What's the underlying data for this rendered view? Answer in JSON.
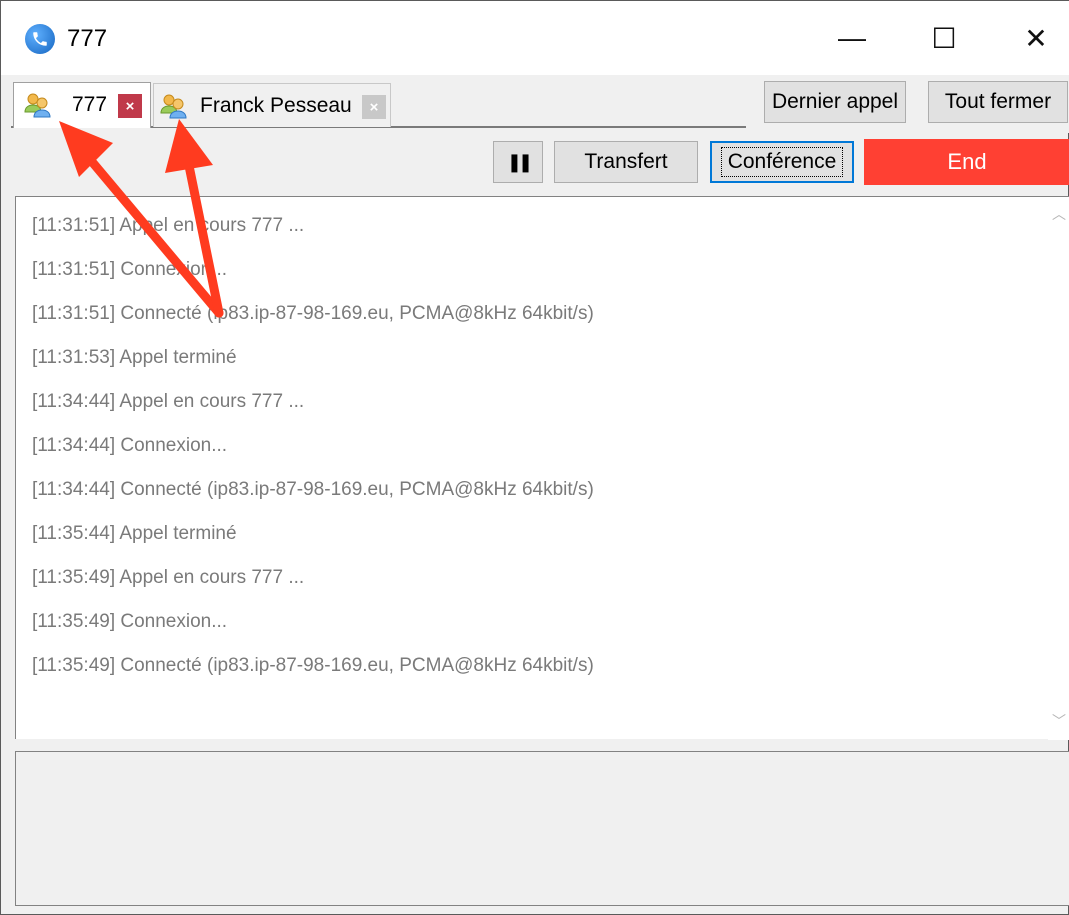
{
  "window": {
    "title": "777",
    "minimize_glyph": "—",
    "maximize_glyph": "☐",
    "close_glyph": "✕"
  },
  "tabs": [
    {
      "label": "777",
      "close_glyph": "×",
      "active": true,
      "icon": "users-icon"
    },
    {
      "label": "Franck Pesseau",
      "close_glyph": "×",
      "active": false,
      "icon": "users-icon"
    }
  ],
  "toolbar": {
    "last_call_label": "Dernier appel",
    "close_all_label": "Tout fermer"
  },
  "call_controls": {
    "pause_glyph": "❚❚",
    "transfer_label": "Transfert",
    "conference_label": "Conférence",
    "end_label": "End",
    "end_color": "#ff4033"
  },
  "log": [
    "[11:31:51]  Appel en cours 777 ...",
    "[11:31:51]  Connexion...",
    "[11:31:51]  Connecté (ip83.ip-87-98-169.eu, PCMA@8kHz 64kbit/s)",
    "[11:31:53]  Appel terminé",
    "[11:34:44]  Appel en cours 777 ...",
    "[11:34:44]  Connexion...",
    "[11:34:44]  Connecté (ip83.ip-87-98-169.eu, PCMA@8kHz 64kbit/s)",
    "[11:35:44]  Appel terminé",
    "[11:35:49]  Appel en cours 777 ...",
    "[11:35:49]  Connexion...",
    "[11:35:49]  Connecté (ip83.ip-87-98-169.eu, PCMA@8kHz 64kbit/s)"
  ],
  "annotation_color": "#ff3b1f"
}
